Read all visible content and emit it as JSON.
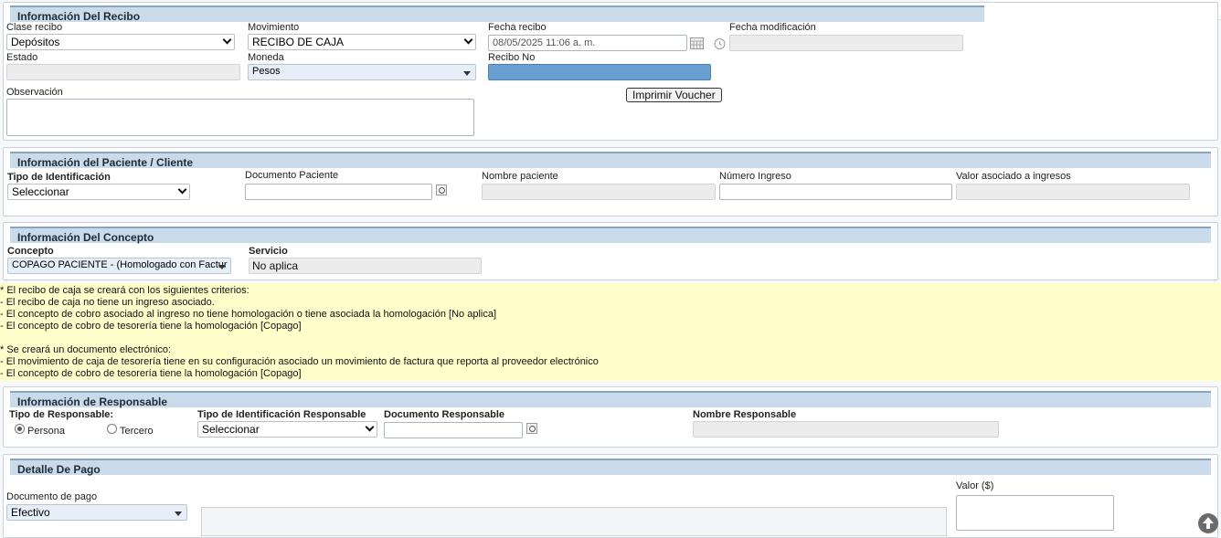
{
  "recibo": {
    "title": "Información Del Recibo",
    "clase_label": "Clase recibo",
    "clase_value": "Depósitos",
    "movimiento_label": "Movimiento",
    "movimiento_value": "RECIBO DE CAJA",
    "fecha_label": "Fecha recibo",
    "fecha_value": "08/05/2025 11:06 a. m.",
    "fecha_mod_label": "Fecha modificación",
    "estado_label": "Estado",
    "moneda_label": "Moneda",
    "moneda_value": "Pesos",
    "recibo_no_label": "Recibo No",
    "observacion_label": "Observación",
    "imprimir_label": "Imprimir Voucher"
  },
  "paciente": {
    "title": "Información del Paciente / Cliente",
    "tipo_id_label": "Tipo de Identificación",
    "tipo_id_value": "Seleccionar",
    "documento_label": "Documento Paciente",
    "nombre_label": "Nombre paciente",
    "ingreso_label": "Número Ingreso",
    "valor_label": "Valor asociado a ingresos"
  },
  "concepto": {
    "title": "Información Del Concepto",
    "concepto_label": "Concepto",
    "concepto_value": "COPAGO PACIENTE - (Homologado con Factur",
    "servicio_label": "Servicio",
    "servicio_value": "No aplica"
  },
  "notes": [
    "* El recibo de caja se creará con los siguientes criterios:",
    "- El recibo de caja no tiene un ingreso asociado.",
    "- El concepto de cobro asociado al ingreso no tiene homologación o tiene asociada la homologación [No aplica]",
    "- El concepto de cobro de tesorería tiene la homologación [Copago]",
    "",
    "* Se creará un documento electrónico:",
    "- El movimiento de caja de tesorería tiene en su configuración asociado un movimiento de factura que reporta al proveedor electrónico",
    "- El concepto de cobro de tesorería tiene la homologación [Copago]"
  ],
  "responsable": {
    "title": "Información de Responsable",
    "tipo_label": "Tipo de Responsable:",
    "persona_label": "Persona",
    "tercero_label": "Tercero",
    "tipo_id_label": "Tipo de Identificación Responsable",
    "tipo_id_value": "Seleccionar",
    "documento_label": "Documento Responsable",
    "nombre_label": "Nombre Responsable"
  },
  "pago": {
    "title": "Detalle De Pago",
    "valor_label": "Valor ($)",
    "doc_label": "Documento de pago",
    "doc_value": "Efectivo"
  },
  "toolbar": {
    "icons": [
      "new-document-icon",
      "copy-icon",
      "save-icon",
      "delete-icon",
      "print-icon",
      "preview-icon",
      "alert-icon",
      "comment-icon"
    ]
  }
}
